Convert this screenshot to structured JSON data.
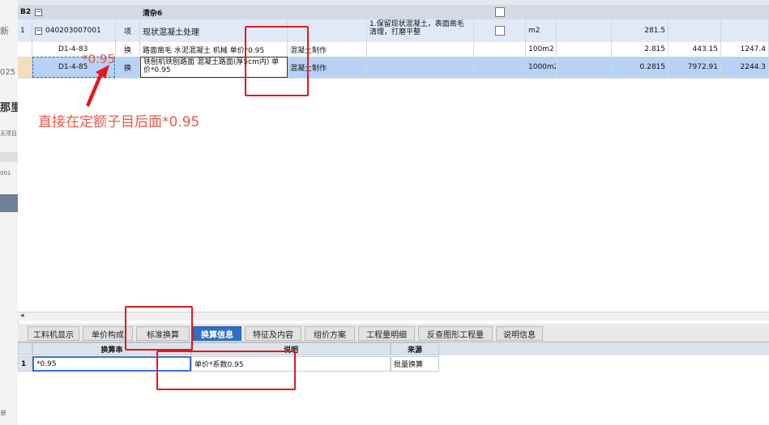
{
  "left_fragments": [
    "新",
    "025",
    "那里",
    "无项目",
    "001",
    "单"
  ],
  "grid": {
    "rows": [
      {
        "num": "B2",
        "code": "",
        "category": "",
        "name": "清杂6",
        "desc": "",
        "unit": "",
        "qty": "",
        "price": "",
        "total": "",
        "kind": "section"
      },
      {
        "num": "1",
        "code": "040203007001",
        "category": "项",
        "name": "现状混凝土处理",
        "desc": "1.保留现状混凝土，表面凿毛清理，打磨平整",
        "unit": "m2",
        "qty": "281.5",
        "price": "",
        "total": "",
        "kind": "item"
      },
      {
        "num": "",
        "code": "D1-4-83",
        "category": "换",
        "name": "路面凿毛 水泥混凝土 机械 单价*0.95",
        "content": "混凝土制作",
        "desc": "",
        "unit": "100m2",
        "qty": "2.815",
        "price": "443.15",
        "total": "1247.4",
        "kind": "sub"
      },
      {
        "num": "",
        "code": "D1-4-85",
        "category": "换",
        "name": "铣刨机铣刨路面 混凝土路面(厚5cm内) 单价*0.95",
        "content": "混凝土制作",
        "desc": "",
        "unit": "1000m2",
        "qty": "0.2815",
        "price": "7972.91",
        "total": "2244.3",
        "kind": "sub-selected"
      }
    ]
  },
  "tabs": [
    "工料机显示",
    "单价构成",
    "标准换算",
    "换算信息",
    "特征及内容",
    "组价方案",
    "工程量明细",
    "反查图形工程量",
    "说明信息"
  ],
  "active_tab": "换算信息",
  "lower": {
    "headers": [
      "换算串",
      "说明",
      "来源"
    ],
    "rows": [
      {
        "num": "1",
        "expr": "*0.95",
        "desc": "单价*系数0.95",
        "source": "批量换算"
      }
    ]
  },
  "annotations": {
    "multiplier": "*0.95",
    "note": "直接在定额子目后面*0.95"
  },
  "colors": {
    "annotation_red": "#e6171b",
    "selected_row": "#b7d2f4",
    "active_tab": "#2f6fc9"
  }
}
